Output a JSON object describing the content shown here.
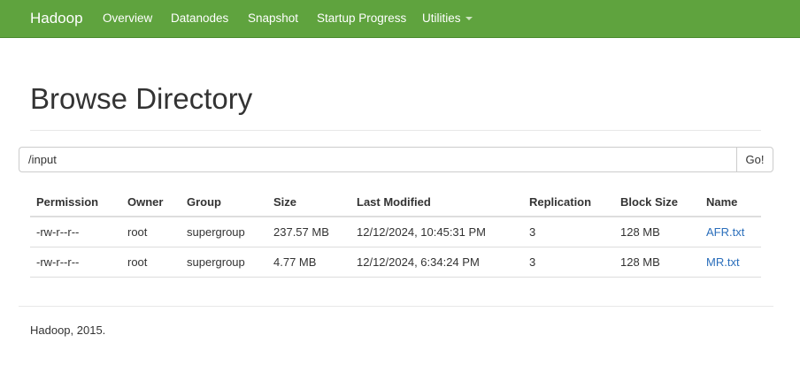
{
  "navbar": {
    "brand": "Hadoop",
    "items": [
      "Overview",
      "Datanodes",
      "Snapshot",
      "Startup Progress",
      "Utilities"
    ],
    "background_color": "#5fa33e"
  },
  "page": {
    "title": "Browse Directory"
  },
  "path_bar": {
    "value": "/input",
    "go_label": "Go!"
  },
  "table": {
    "headers": [
      "Permission",
      "Owner",
      "Group",
      "Size",
      "Last Modified",
      "Replication",
      "Block Size",
      "Name"
    ],
    "rows": [
      [
        "-rw-r--r--",
        "root",
        "supergroup",
        "237.57 MB",
        "12/12/2024, 10:45:31 PM",
        "3",
        "128 MB",
        "AFR.txt"
      ],
      [
        "-rw-r--r--",
        "root",
        "supergroup",
        "4.77 MB",
        "12/12/2024, 6:34:24 PM",
        "3",
        "128 MB",
        "MR.txt"
      ]
    ],
    "link_color": "#2a6ebb"
  },
  "footer": {
    "text": "Hadoop, 2015."
  }
}
